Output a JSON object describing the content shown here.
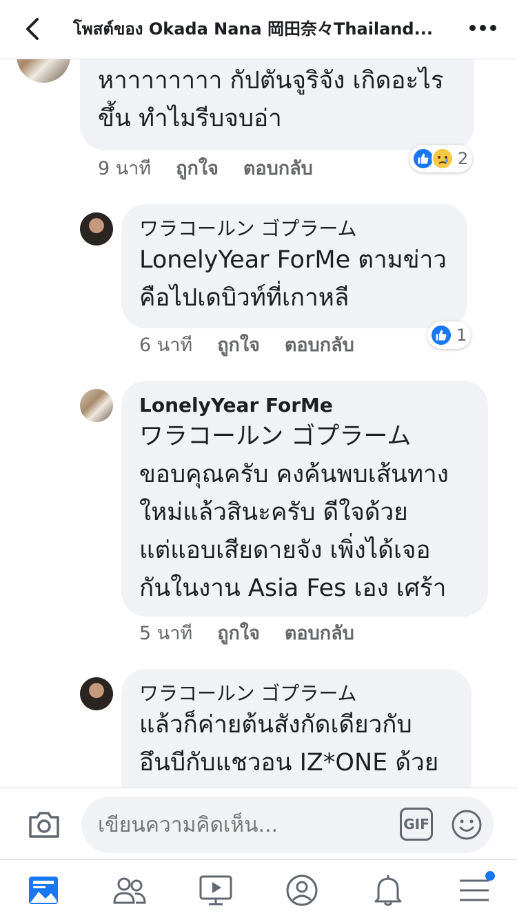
{
  "header": {
    "title": "โพสต์ของ Okada Nana 岡田奈々Thailand...",
    "back_icon": "chevron-left-icon",
    "more_icon": "more-dots-icon"
  },
  "comments": [
    {
      "author": "",
      "lines": [
        "หาาาาาาาา กัปตันจูริจัง เกิดอะไร",
        "ขึ้น ทำไมรีบจบอ่า"
      ],
      "time": "9 นาที",
      "like": "ถูกใจ",
      "reply": "ตอบกลับ",
      "reaction_count": "2",
      "reactions": [
        "like-icon",
        "sad-icon"
      ]
    },
    {
      "author": "ワラコールン ゴプラーム",
      "lines": [
        "LonelyYear ForMe ตามข่าว",
        "คือไปเดบิวท์ที่เกาหลี"
      ],
      "time": "6 นาที",
      "like": "ถูกใจ",
      "reply": "ตอบกลับ",
      "reaction_count": "1",
      "reactions": [
        "like-icon"
      ]
    },
    {
      "author": "LonelyYear ForMe",
      "lines": [
        "ワラコールン ゴプラーム",
        "ขอบคุณครับ คงค้นพบเส้นทาง",
        "ใหม่แล้วสินะครับ ดีใจด้วย",
        "แต่แอบเสียดายจัง เพิ่งได้เจอ",
        "กันในงาน Asia Fes เอง เศร้า"
      ],
      "time": "5 นาที",
      "like": "ถูกใจ",
      "reply": "ตอบกลับ"
    },
    {
      "author": "ワラコールン ゴプラーム",
      "lines": [
        "แล้วก็ค่ายต้นสังกัดเดียวกับ",
        "อึนบีกับแชวอน IZ*ONE ด้วย"
      ]
    }
  ],
  "composer": {
    "placeholder": "เขียนความคิดเห็น...",
    "gif_label": "GIF",
    "camera_icon": "camera-icon",
    "emoji_icon": "emoji-icon"
  },
  "nav": {
    "items": [
      "news-feed-icon",
      "friends-icon",
      "watch-icon",
      "profile-icon",
      "notifications-icon",
      "menu-icon"
    ],
    "active_color": "#1877f2"
  }
}
